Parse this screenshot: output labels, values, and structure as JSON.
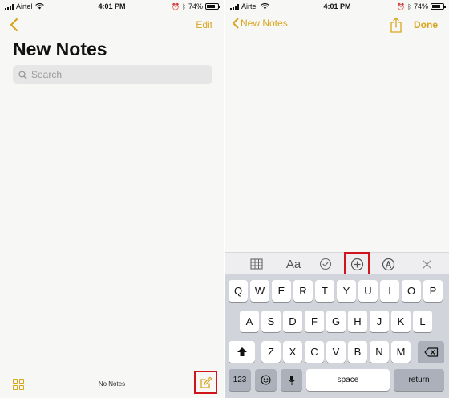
{
  "status_bar": {
    "carrier": "Airtel",
    "time": "4:01 PM",
    "battery": "74%"
  },
  "left_screen": {
    "edit_label": "Edit",
    "title": "New Notes",
    "search_placeholder": "Search",
    "footer_text": "No Notes"
  },
  "right_screen": {
    "back_label": "New Notes",
    "done_label": "Done",
    "toolbar": [
      "table-icon",
      "Aa",
      "checklist-icon",
      "plus-circle-icon",
      "markup-icon",
      "close-icon"
    ],
    "toolbar_text": "Aa",
    "keyboard": {
      "row1": [
        "Q",
        "W",
        "E",
        "R",
        "T",
        "Y",
        "U",
        "I",
        "O",
        "P"
      ],
      "row2": [
        "A",
        "S",
        "D",
        "F",
        "G",
        "H",
        "J",
        "K",
        "L"
      ],
      "row3": [
        "Z",
        "X",
        "C",
        "V",
        "B",
        "N",
        "M"
      ],
      "numbers_label": "123",
      "space_label": "space",
      "return_label": "return"
    }
  },
  "colors": {
    "accent": "#d9a51f",
    "highlight_box": "#d0141c"
  }
}
